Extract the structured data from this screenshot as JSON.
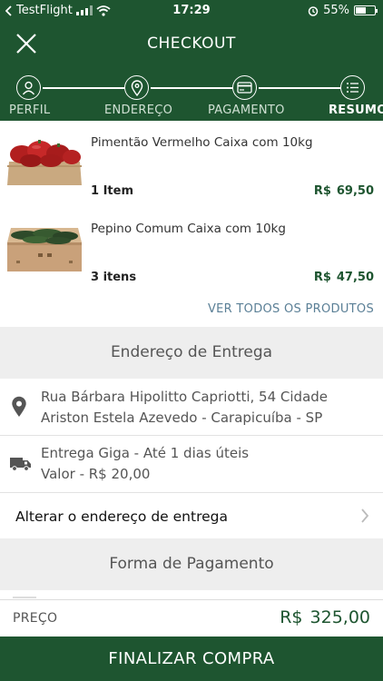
{
  "status_bar": {
    "carrier": "TestFlight",
    "time": "17:29",
    "battery": "55%",
    "battery_level": 0.55
  },
  "header": {
    "title": "CHECKOUT"
  },
  "steps": [
    {
      "label": "PERFIL",
      "icon": "user-icon",
      "active": false
    },
    {
      "label": "ENDEREÇO",
      "icon": "location-pin-icon",
      "active": false
    },
    {
      "label": "PAGAMENTO",
      "icon": "credit-card-icon",
      "active": false
    },
    {
      "label": "RESUMO",
      "icon": "list-icon",
      "active": true
    }
  ],
  "products": [
    {
      "name": "Pimentão Vermelho Caixa com 10kg",
      "quantity": "1 Item",
      "currency": "R$",
      "price": "69,50"
    },
    {
      "name": "Pepino Comum Caixa com 10kg",
      "quantity": "3 itens",
      "currency": "R$",
      "price": "47,50"
    }
  ],
  "see_all_label": "VER TODOS OS PRODUTOS",
  "delivery": {
    "section_title": "Endereço de Entrega",
    "address": "Rua Bárbara Hipolitto Capriotti, 54  Cidade Ariston Estela Azevedo - Carapicuíba - SP",
    "shipping_line1": "Entrega Giga - Até 1 dias úteis",
    "shipping_line2": "Valor - R$  20,00",
    "change_label": "Alterar o endereço de entrega"
  },
  "payment": {
    "section_title": "Forma de Pagamento"
  },
  "total": {
    "label": "PREÇO",
    "currency": "R$",
    "value": "325,00"
  },
  "finalize_label": "FINALIZAR COMPRA",
  "colors": {
    "primary": "#1e5530",
    "price": "#1e5530",
    "link": "#5a7f96",
    "section_bg": "#eeeeee"
  }
}
